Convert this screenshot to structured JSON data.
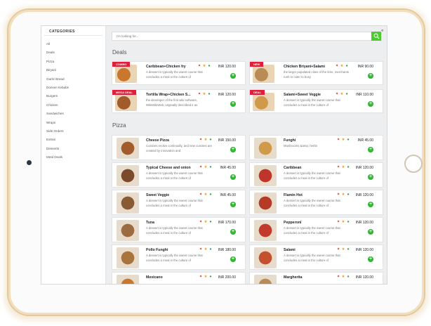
{
  "sidebar": {
    "title": "CATEGORIES",
    "items": [
      "All",
      "Deals",
      "Pizza",
      "Biryani",
      "Garlic Bread",
      "Donner Kebabs",
      "Burgers",
      "Chicken",
      "Sandwiches",
      "Wraps",
      "Side Orders",
      "Extras",
      "Desserts",
      "Meal Deals"
    ]
  },
  "search": {
    "placeholder": "I'm looking for..."
  },
  "collapse_label": "«",
  "sections": {
    "deals": "Deals",
    "pizza": "Pizza"
  },
  "deals": [
    {
      "ribbon": "COMBO",
      "name": "Caribbean+Chicken fry",
      "price": "INR 120.00",
      "desc": "A dessert is typically the sweet course that concludes a meal in the culture of"
    },
    {
      "ribbon": "NEW",
      "name": "Chicken Briyani+Salami",
      "price": "INR 90.00",
      "desc": "the larger populated cities of the time, merchants rush to cater to busy"
    },
    {
      "ribbon": "MEGA DEAL",
      "name": "Tortilla Wrap+Chicken S...",
      "price": "INR 120.00",
      "desc": "the developer of the first wiki software, WikiWikiWeb, originally described it as"
    },
    {
      "ribbon": "DEAL",
      "name": "Salami+Sweet Veggie",
      "price": "INR 110.00",
      "desc": "A dessert is typically the sweet course that concludes a meal in the culture of"
    }
  ],
  "pizzas": [
    {
      "name": "Cheese Pizza",
      "price": "INR 150.00",
      "desc": "Cuisines evolve continually, and new cuisines are created by innovation and"
    },
    {
      "name": "Funghi",
      "price": "INR 45.00",
      "desc": "Mushrooms &amp; herbs"
    },
    {
      "name": "Typical Cheese and onion",
      "price": "INR 45.00",
      "desc": "A dessert is typically the sweet course that concludes a meal in the culture of"
    },
    {
      "name": "Caribbean",
      "price": "INR 120.00",
      "desc": "A dessert is typically the sweet course that concludes a meal in the culture of"
    },
    {
      "name": "Sweet Veggie",
      "price": "INR 45.00",
      "desc": "A dessert is typically the sweet course that concludes a meal in the culture of"
    },
    {
      "name": "Flamin Hot",
      "price": "INR 120.00",
      "desc": "A dessert is typically the sweet course that concludes a meal in the culture of"
    },
    {
      "name": "Tuna",
      "price": "INR 170.00",
      "desc": "A dessert is typically the sweet course that concludes a meal in the culture of"
    },
    {
      "name": "Pepperoni",
      "price": "INR 120.00",
      "desc": "A dessert is typically the sweet course that concludes a meal in the culture of"
    },
    {
      "name": "Pollo Funghi",
      "price": "INR 180.00",
      "desc": "A dessert is typically the sweet course that concludes a meal in the culture of"
    },
    {
      "name": "Salami",
      "price": "INR 120.00",
      "desc": "A dessert is typically the sweet course that concludes a meal in the culture of"
    },
    {
      "name": "Mexicano",
      "price": "INR 200.00",
      "desc": ""
    },
    {
      "name": "Margherita",
      "price": "INR 120.00",
      "desc": ""
    }
  ],
  "colors": {
    "accent_green": "#2eb82e",
    "search_green": "#4ccb2f",
    "ribbon_red": "#e0203a",
    "frame_gold": "#e3c99c"
  },
  "icon_names": [
    "chili-icon",
    "star-icon",
    "leaf-icon"
  ]
}
